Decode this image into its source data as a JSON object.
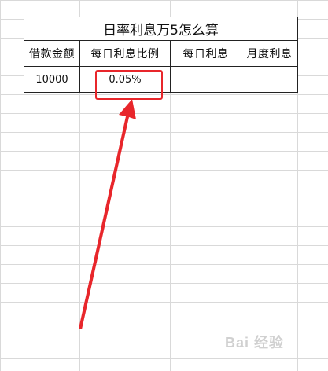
{
  "table": {
    "title": "日率利息万5怎么算",
    "headers": [
      "借款金额",
      "每日利息比例",
      "每日利息",
      "月度利息"
    ],
    "row": [
      "10000",
      "0.05%",
      "",
      ""
    ]
  },
  "annotation": {
    "highlight_color": "#e8262b",
    "arrow_color": "#e8262b"
  },
  "watermark": {
    "text": "Bai 经验"
  }
}
